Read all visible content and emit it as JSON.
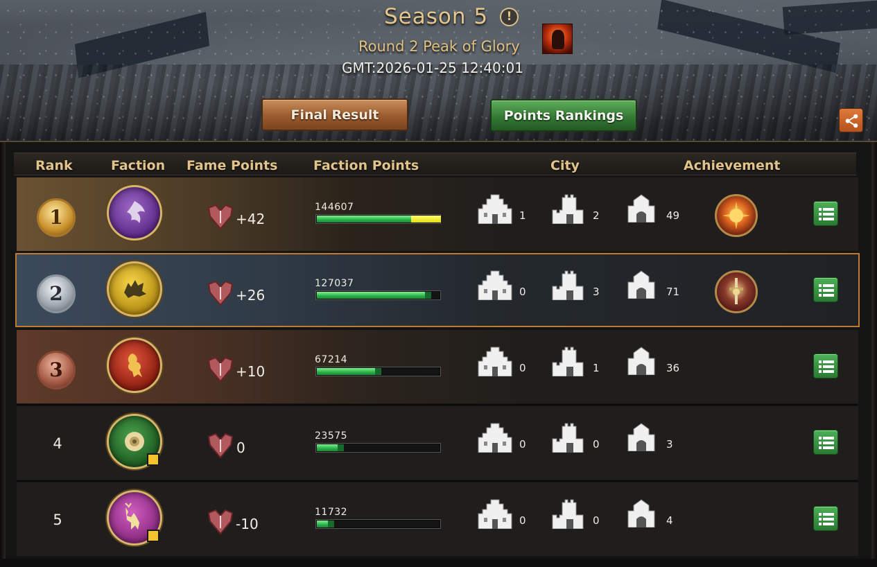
{
  "header": {
    "season_title": "Season 5",
    "round_title": "Round 2 Peak of Glory",
    "gmt": "GMT:2026-01-25 12:40:01",
    "final_result_label": "Final Result",
    "points_rankings_label": "Points Rankings",
    "info_icon": "exclamation-icon",
    "share_icon": "share-icon"
  },
  "columns": {
    "rank": "Rank",
    "faction": "Faction",
    "fame": "Fame Points",
    "faction_points": "Faction Points",
    "city": "City",
    "achievement": "Achievement"
  },
  "colors": {
    "accent_gold": "#e2c48a",
    "green_button": "#347a34",
    "bronze_button": "#9a5b2e",
    "selected_border": "#c07a32",
    "bar_green": "#2bb04a",
    "bar_yellow": "#e4dc10"
  },
  "rows": [
    {
      "rank": "1",
      "medal": "gold",
      "faction": "purple-dragon-sigil",
      "fame": "+42",
      "points": "144607",
      "progress_green": 0.76,
      "progress_yellow": 0.24,
      "city_a": "1",
      "city_b": "2",
      "city_c": "49",
      "achievement": "sun-emblem"
    },
    {
      "rank": "2",
      "medal": "silver",
      "faction": "wolf-sigil",
      "fame": "+26",
      "points": "127037",
      "progress_green": 0.87,
      "progress_yellow": 0,
      "city_a": "0",
      "city_b": "3",
      "city_c": "71",
      "achievement": "sword-emblem"
    },
    {
      "rank": "3",
      "medal": "bronze",
      "faction": "lion-sigil",
      "fame": "+10",
      "points": "67214",
      "progress_green": 0.47,
      "progress_yellow": 0,
      "city_a": "0",
      "city_b": "1",
      "city_c": "36",
      "achievement": ""
    },
    {
      "rank": "4",
      "medal": "",
      "faction": "rose-sigil",
      "fame": "0",
      "points": "23575",
      "progress_green": 0.17,
      "progress_yellow": 0,
      "city_a": "0",
      "city_b": "0",
      "city_c": "3",
      "achievement": ""
    },
    {
      "rank": "5",
      "medal": "",
      "faction": "stag-sigil",
      "fame": "-10",
      "points": "11732",
      "progress_green": 0.09,
      "progress_yellow": 0,
      "city_a": "0",
      "city_b": "0",
      "city_c": "4",
      "achievement": ""
    }
  ]
}
